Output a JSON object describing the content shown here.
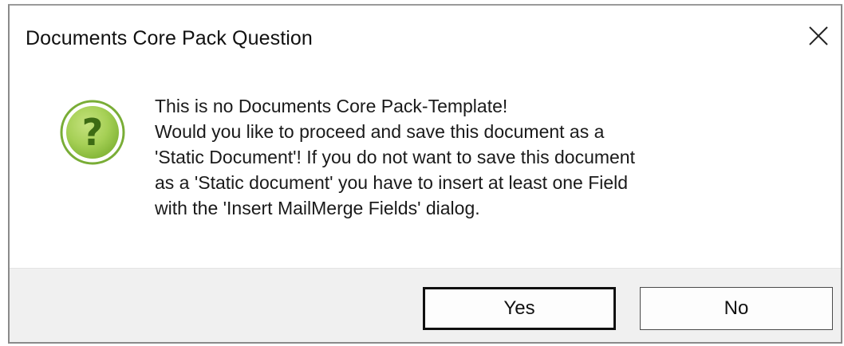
{
  "dialog": {
    "title": "Documents Core Pack Question",
    "close_icon": "close-icon",
    "icon": "question-icon",
    "icon_colors": {
      "fill": "#8cc63f",
      "ring": "#6fa832",
      "glyph": "#ffffff"
    },
    "message_lines": [
      "This is no Documents Core Pack-Template!",
      "Would you like to proceed and save this document as a",
      "'Static Document'! If you do not want to save this document",
      "as a 'Static document' you have to insert at least one Field",
      "with the 'Insert MailMerge Fields' dialog."
    ],
    "buttons": {
      "yes_label": "Yes",
      "no_label": "No"
    }
  }
}
